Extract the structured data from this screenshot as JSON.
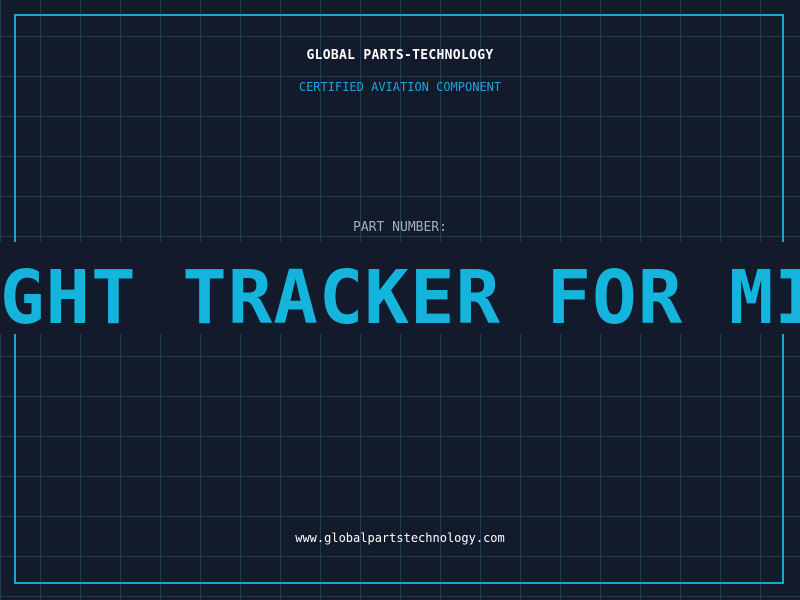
{
  "header": {
    "company": "GLOBAL PARTS-TECHNOLOGY",
    "subtitle": "CERTIFIED AVIATION COMPONENT"
  },
  "part": {
    "label": "PART NUMBER:",
    "value": "GHT TRACKER FOR MIL"
  },
  "footer": {
    "url": "www.globalpartstechnology.com"
  },
  "colors": {
    "background": "#121a2c",
    "grid": "#1d3e55",
    "accent": "#1ba4cf",
    "part_number": "#14b4dc",
    "label": "#a3adbd",
    "text": "#ffffff"
  }
}
